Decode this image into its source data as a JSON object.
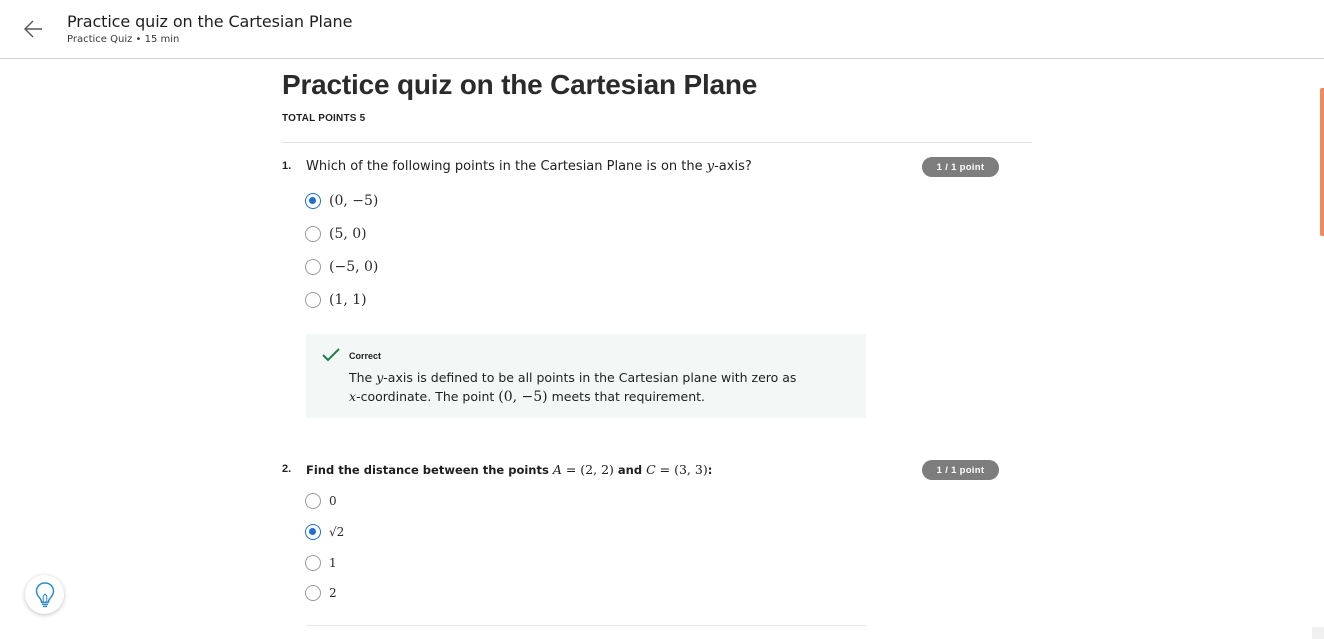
{
  "header": {
    "title": "Practice quiz on the Cartesian Plane",
    "subtitle": "Practice Quiz • 15 min",
    "back_icon": "arrow-left-icon"
  },
  "main": {
    "title": "Practice quiz on the Cartesian Plane",
    "total_points": "TOTAL POINTS 5"
  },
  "questions": [
    {
      "number": "1.",
      "text_pre": "Which of the following points in the Cartesian Plane is on the ",
      "text_var": "y",
      "text_post": "-axis?",
      "points": "1 / 1 point",
      "options": [
        {
          "label": "(0, −5)",
          "selected": true
        },
        {
          "label": "(5, 0)",
          "selected": false
        },
        {
          "label": "(−5, 0)",
          "selected": false
        },
        {
          "label": "(1, 1)",
          "selected": false
        }
      ],
      "feedback": {
        "title": "Correct",
        "line1_pre": "The ",
        "line1_var": "y",
        "line1_post": "-axis is defined to be all points in the Cartesian plane with zero as",
        "line2_var": "x",
        "line2_mid": "-coordinate. The point ",
        "line2_math": "(0, −5)",
        "line2_post": " meets that requirement."
      }
    },
    {
      "number": "2.",
      "text_pre": "Find the distance between the points ",
      "text_a": "A",
      "text_a_val": " = (2, 2)",
      "text_and": " and ",
      "text_c": "C",
      "text_c_val": " = (3, 3)",
      "text_post": ":",
      "points": "1 / 1 point",
      "options": [
        {
          "label": "0",
          "selected": false
        },
        {
          "label": "√2",
          "selected": true
        },
        {
          "label": "1",
          "selected": false
        },
        {
          "label": "2",
          "selected": false
        }
      ]
    }
  ],
  "colors": {
    "accent": "#1f6fd1",
    "correct": "#1e7e4a",
    "pill": "#7d7d7d",
    "scroll_accent": "#f08a5d"
  },
  "icons": {
    "hint": "lightbulb-icon",
    "check": "checkmark-icon"
  }
}
